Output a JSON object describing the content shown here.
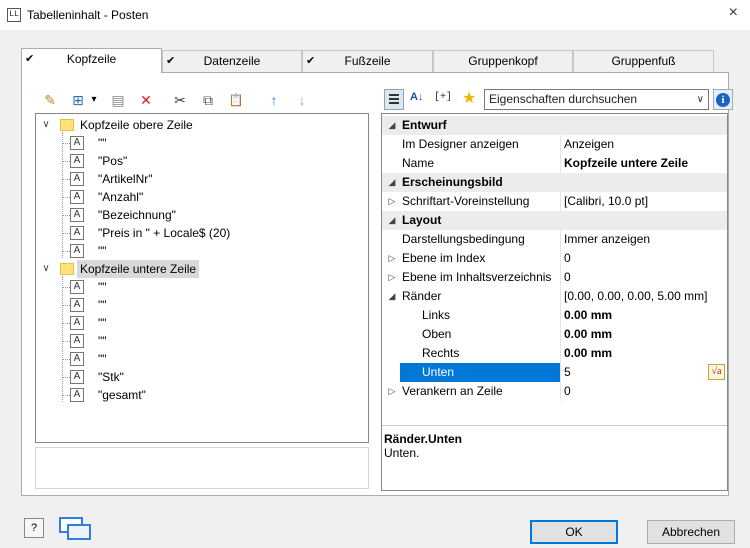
{
  "window": {
    "title": "Tabelleninhalt - Posten",
    "app_icon_text": "LL",
    "close_label": "×"
  },
  "tabs": [
    {
      "label": "Kopfzeile",
      "checked": true,
      "active": true
    },
    {
      "label": "Datenzeile",
      "checked": true,
      "active": false
    },
    {
      "label": "Fußzeile",
      "checked": true,
      "active": false
    },
    {
      "label": "Gruppenkopf",
      "checked": false,
      "active": false
    },
    {
      "label": "Gruppenfuß",
      "checked": false,
      "active": false
    }
  ],
  "check_mark": "✔",
  "left_toolbar": [
    {
      "icon": "magic-wand-icon",
      "glyph": "✎"
    },
    {
      "icon": "insert-row-icon",
      "glyph": "⊞"
    },
    {
      "icon": "dropdown-icon",
      "glyph": "▾"
    },
    {
      "icon": "properties-icon",
      "glyph": "▤"
    },
    {
      "icon": "delete-icon",
      "glyph": "✕"
    },
    {
      "icon": "cut-icon",
      "glyph": "✂"
    },
    {
      "icon": "copy-icon",
      "glyph": "⧉"
    },
    {
      "icon": "paste-icon",
      "glyph": "📋"
    },
    {
      "icon": "move-up-icon",
      "glyph": "↑"
    },
    {
      "icon": "move-down-icon",
      "glyph": "↓"
    }
  ],
  "tree": {
    "groups": [
      {
        "label": "Kopfzeile obere Zeile",
        "expanded": true,
        "selected": false,
        "items": [
          "\"\"",
          "\"Pos\"",
          "\"ArtikelNr\"",
          "\"Anzahl\"",
          "\"Bezeichnung\"",
          "\"Preis in \" + Locale$ (20)",
          "\"\""
        ]
      },
      {
        "label": "Kopfzeile untere Zeile",
        "expanded": true,
        "selected": true,
        "items": [
          "\"\"",
          "\"\"",
          "\"\"",
          "\"\"",
          "\"\"",
          "\"Stk\"",
          "\"gesamt\""
        ]
      }
    ],
    "field_icon_text": "A",
    "expand_glyph": "∨"
  },
  "right_toolbar": {
    "categorized_icon": "categorized-icon",
    "sort_icon": "sort-az-icon",
    "sort_glyph": "A↓",
    "expand_all_icon": "expand-all-icon",
    "expand_all_glyph": "[+]",
    "favorite_icon": "star-icon",
    "search_placeholder": "Eigenschaften durchsuchen",
    "info_glyph": "i"
  },
  "properties": {
    "rows": [
      {
        "kind": "cat",
        "name": "Entwurf",
        "value": "",
        "exp": "◢"
      },
      {
        "kind": "prop",
        "name": "Im Designer anzeigen",
        "value": "Anzeigen",
        "exp": ""
      },
      {
        "kind": "prop",
        "name": "Name",
        "value": "Kopfzeile untere Zeile",
        "exp": "",
        "bold": true
      },
      {
        "kind": "cat",
        "name": "Erscheinungsbild",
        "value": "",
        "exp": "◢"
      },
      {
        "kind": "prop",
        "name": "Schriftart-Voreinstellung",
        "value": "[Calibri, 10.0 pt]",
        "exp": "▷"
      },
      {
        "kind": "cat",
        "name": "Layout",
        "value": "",
        "exp": "◢"
      },
      {
        "kind": "prop",
        "name": "Darstellungsbedingung",
        "value": "Immer anzeigen",
        "exp": ""
      },
      {
        "kind": "prop",
        "name": "Ebene im Index",
        "value": "0",
        "exp": "▷"
      },
      {
        "kind": "prop",
        "name": "Ebene im Inhaltsverzeichnis",
        "value": "0",
        "exp": "▷"
      },
      {
        "kind": "prop",
        "name": "Ränder",
        "value": "[0.00, 0.00, 0.00, 5.00 mm]",
        "exp": "◢"
      },
      {
        "kind": "sub",
        "name": "Links",
        "value": "0.00 mm",
        "bold": true
      },
      {
        "kind": "sub",
        "name": "Oben",
        "value": "0.00 mm",
        "bold": true
      },
      {
        "kind": "sub",
        "name": "Rechts",
        "value": "0.00 mm",
        "bold": true
      },
      {
        "kind": "sub",
        "name": "Unten",
        "value": "5",
        "selected": true
      },
      {
        "kind": "prop",
        "name": "Verankern an Zeile",
        "value": "0",
        "exp": "▷"
      }
    ],
    "formula_glyph": "√a",
    "description_title": "Ränder.Unten",
    "description_text": "Unten."
  },
  "footer": {
    "help_glyph": "?",
    "ok_label": "OK",
    "cancel_label": "Abbrechen"
  }
}
